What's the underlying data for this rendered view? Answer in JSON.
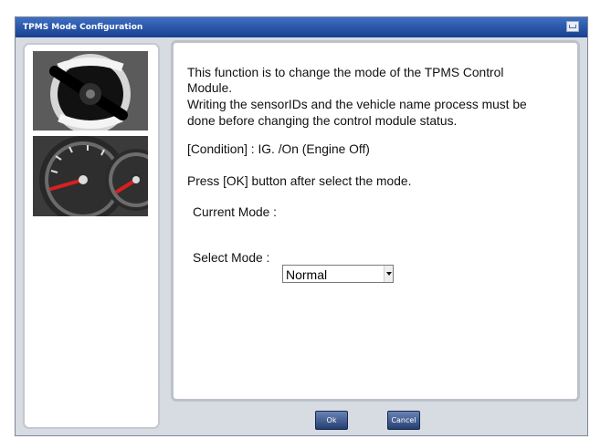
{
  "window": {
    "title": "TPMS Mode Configuration",
    "icon": "help-book-icon"
  },
  "content": {
    "line1": "This function is to change the mode of the TPMS Control",
    "line2": "Module.",
    "line3": "Writing the sensorIDs and the vehicle name process must be",
    "line4": " done before changing the control module status.",
    "condition": "[Condition] : IG. /On (Engine Off)",
    "press_ok": "Press [OK] button after select the mode.",
    "current_mode_label": "Current Mode :",
    "select_mode_label": "Select Mode :",
    "select_mode_value": "Normal"
  },
  "buttons": {
    "ok": "Ok",
    "cancel": "Cancel"
  },
  "images": {
    "ignition": "ignition-key-image",
    "gauge": "instrument-gauge-image"
  }
}
